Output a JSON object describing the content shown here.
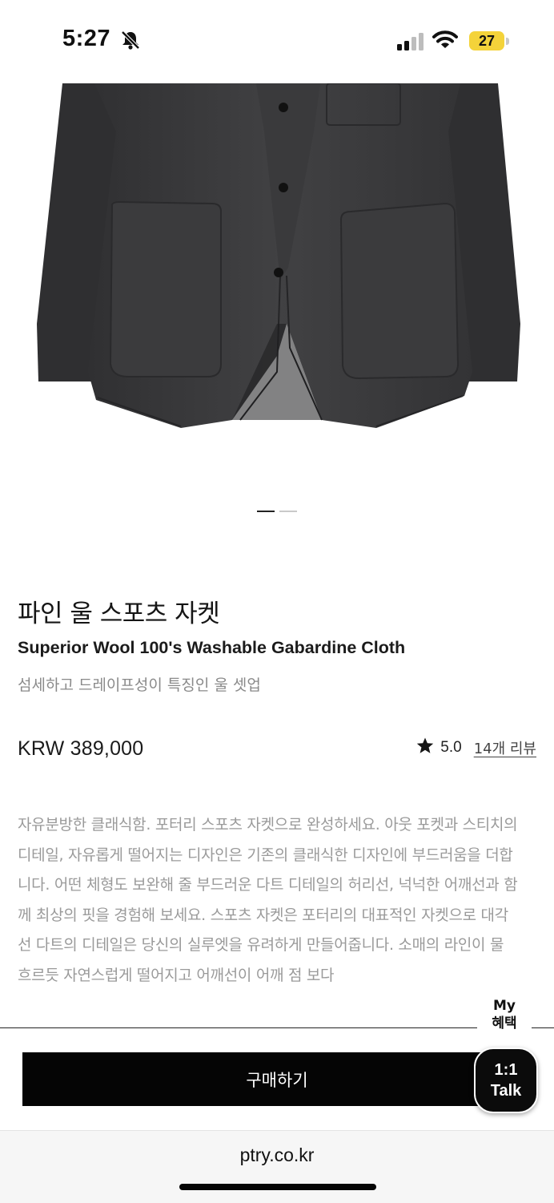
{
  "status_bar": {
    "time": "5:27",
    "battery": "27",
    "icons": [
      "bell-slash-icon",
      "signal-icon",
      "wifi-icon",
      "battery-icon"
    ]
  },
  "product": {
    "title_ko": "파인 울 스포츠 자켓",
    "title_en": "Superior Wool 100's Washable Gabardine Cloth",
    "subtitle": "섬세하고 드레이프성이 특징인 울 셋업",
    "price": "KRW 389,000",
    "rating_score": "5.0",
    "review_link": "14개 리뷰",
    "description": "자유분방한 클래식함. 포터리 스포츠 자켓으로 완성하세요. 아웃 포켓과 스티치의 디테일, 자유롭게 떨어지는 디자인은 기존의 클래식한 디자인에 부드러움을 더합니다. 어떤 체형도 보완해 줄 부드러운 다트 디테일의 허리선, 넉넉한 어깨선과 함께 최상의 핏을 경험해 보세요. 스포츠 자켓은 포터리의 대표적인 자켓으로 대각선 다트의 디테일은 당신의 실루엣을 유려하게 만들어줍니다. 소매의 라인이 물 흐르듯 자연스럽게 떨어지고 어깨선이 어깨 점 보다"
  },
  "carousel": {
    "count": 2,
    "active_index": 0
  },
  "floating": {
    "benefit_line1": "My",
    "benefit_line2": "혜택",
    "talk_line1": "1:1",
    "talk_line2": "Talk"
  },
  "buy_label": "구매하기",
  "url": "ptry.co.kr",
  "colors": {
    "jacket": "#3c3c3e",
    "button_bg": "#050505",
    "battery": "#f4d33a"
  }
}
